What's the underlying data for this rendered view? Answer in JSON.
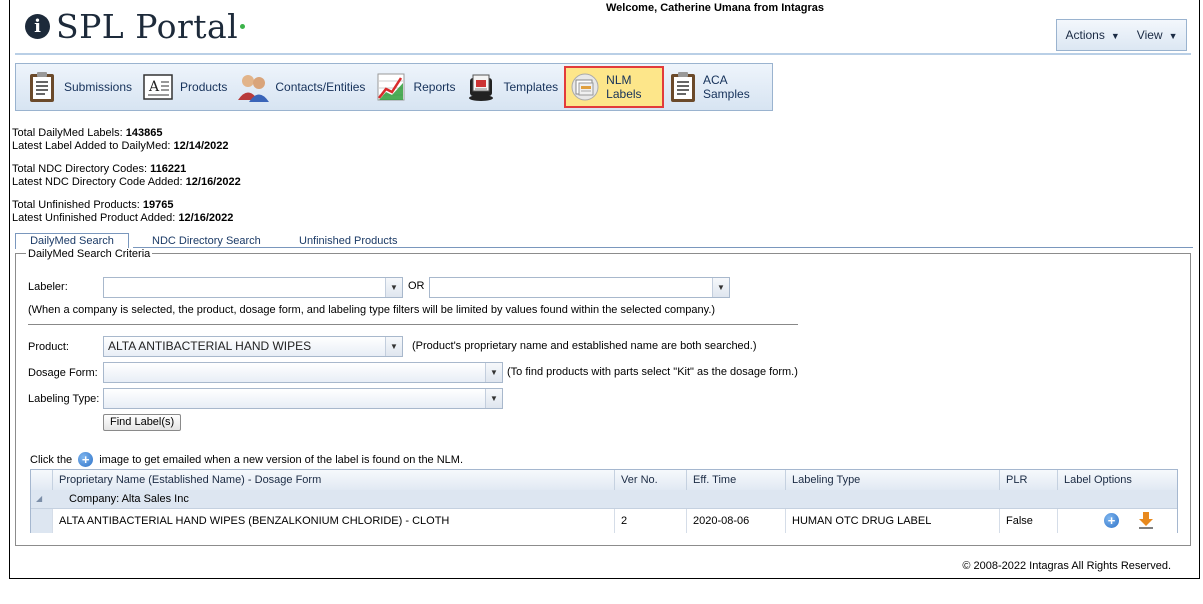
{
  "header": {
    "logo_text": "SPL Portal",
    "logo_letter": "i",
    "welcome": "Welcome, Catherine Umana from Intagras",
    "actions_label": "Actions",
    "view_label": "View"
  },
  "toolbar": {
    "items": [
      {
        "label": "Submissions",
        "icon": "clipboard-icon"
      },
      {
        "label": "Products",
        "icon": "document-a-icon"
      },
      {
        "label": "Contacts/Entities",
        "icon": "users-icon"
      },
      {
        "label": "Reports",
        "icon": "chart-icon"
      },
      {
        "label": "Templates",
        "icon": "rolodex-icon"
      },
      {
        "label": "NLM Labels",
        "icon": "labels-icon",
        "active": true
      },
      {
        "label": "ACA Samples",
        "icon": "clipboard-icon"
      }
    ]
  },
  "stats": {
    "total_dailymed_label": "Total DailyMed Labels:",
    "total_dailymed_value": "143865",
    "latest_label_label": "Latest Label Added to DailyMed:",
    "latest_label_value": "12/14/2022",
    "total_ndc_label": "Total NDC Directory Codes:",
    "total_ndc_value": "116221",
    "latest_ndc_label": "Latest NDC Directory Code Added:",
    "latest_ndc_value": "12/16/2022",
    "total_unfinished_label": "Total Unfinished Products:",
    "total_unfinished_value": "19765",
    "latest_unfinished_label": "Latest Unfinished Product Added:",
    "latest_unfinished_value": "12/16/2022"
  },
  "tabs": [
    "DailyMed Search",
    "NDC Directory Search",
    "Unfinished Products"
  ],
  "criteria": {
    "legend": "DailyMed Search Criteria",
    "labeler_label": "Labeler:",
    "labeler_value": "",
    "or_label": "OR",
    "labeler2_value": "",
    "company_note": "(When a company is selected, the product, dosage form, and labeling type filters will be limited by values found within the selected company.)",
    "product_label": "Product:",
    "product_value": "ALTA ANTIBACTERIAL HAND WIPES",
    "product_note": "(Product's proprietary name and established name are both searched.)",
    "dosage_label": "Dosage Form:",
    "dosage_value": "",
    "dosage_note": "(To find products with parts select \"Kit\" as the dosage form.)",
    "labeling_label": "Labeling Type:",
    "labeling_value": "",
    "find_button": "Find Label(s)",
    "hint_prefix": "Click the",
    "hint_suffix": "image to get emailed when a new version of the label is found on the NLM."
  },
  "grid": {
    "columns": [
      "Proprietary Name (Established Name) - Dosage Form",
      "Ver No.",
      "Eff. Time",
      "Labeling Type",
      "PLR",
      "Label Options"
    ],
    "group_label": "Company: Alta Sales Inc",
    "rows": [
      {
        "name": "ALTA ANTIBACTERIAL HAND WIPES (BENZALKONIUM CHLORIDE) - CLOTH",
        "ver": "2",
        "eff": "2020-08-06",
        "type": "HUMAN OTC DRUG LABEL",
        "plr": "False"
      }
    ]
  },
  "footer": "© 2008-2022 Intagras All Rights Reserved."
}
